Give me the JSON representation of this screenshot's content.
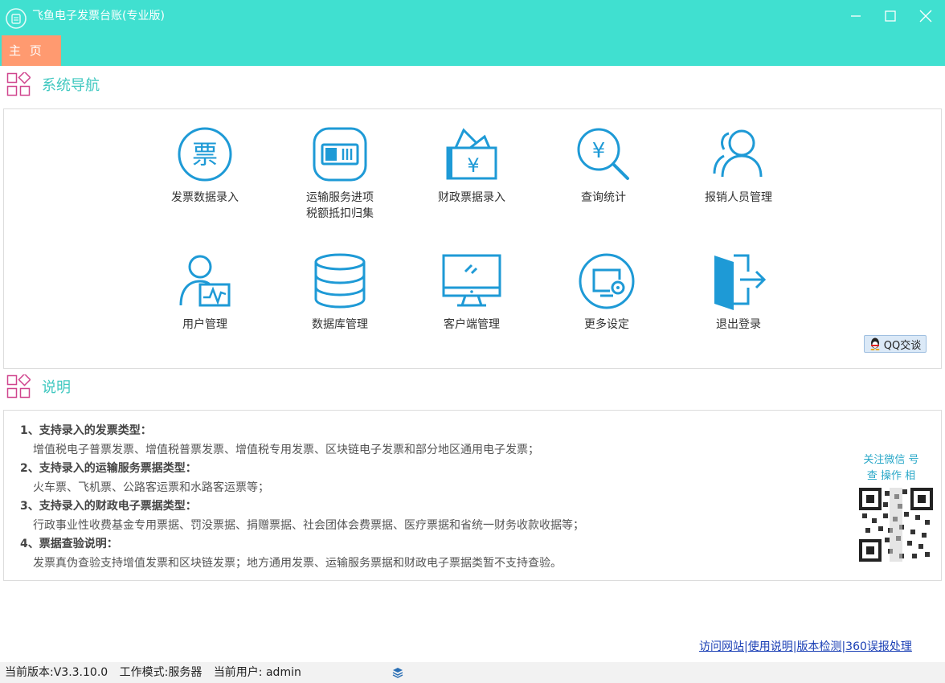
{
  "window": {
    "title": "飞鱼电子发票台账(专业版)",
    "tab_home": "主 页"
  },
  "colors": {
    "titlebar": "#40e0d0",
    "tab": "#ff9a70",
    "section_title": "#40c8c0",
    "icon_blue": "#1e9ad6",
    "link": "#1a3fb5"
  },
  "nav_section": {
    "title": "系统导航",
    "items": [
      {
        "label": "发票数据录入",
        "icon": "invoice-icon"
      },
      {
        "label": "运输服务进项\n税额抵扣归集",
        "icon": "ticket-icon"
      },
      {
        "label": "财政票据录入",
        "icon": "wallet-icon"
      },
      {
        "label": "查询统计",
        "icon": "search-yen-icon"
      },
      {
        "label": "报销人员管理",
        "icon": "users-icon"
      },
      {
        "label": "用户管理",
        "icon": "user-chart-icon"
      },
      {
        "label": "数据库管理",
        "icon": "database-icon"
      },
      {
        "label": "客户端管理",
        "icon": "monitor-icon"
      },
      {
        "label": "更多设定",
        "icon": "settings-icon"
      },
      {
        "label": "退出登录",
        "icon": "logout-icon"
      }
    ],
    "qq_button": "QQ交谈"
  },
  "desc_section": {
    "title": "说明",
    "items": [
      {
        "heading": "1、支持录入的发票类型：",
        "text": "增值税电子普票发票、增值税普票发票、增值税专用发票、区块链电子发票和部分地区通用电子发票；"
      },
      {
        "heading": "2、支持录入的运输服务票据类型：",
        "text": "火车票、飞机票、公路客运票和水路客运票等；"
      },
      {
        "heading": "3、支持录入的财政电子票据类型：",
        "text": "行政事业性收费基金专用票据、罚没票据、捐赠票据、社会团体会费票据、医疗票据和省统一财务收款收据等；"
      },
      {
        "heading": "4、票据查验说明：",
        "text": "发票真伪查验支持增值发票和区块链发票；地方通用发票、运输服务票据和财政电子票据类暂不支持查验。"
      }
    ],
    "wechat_line1": "关注微信    号",
    "wechat_line2": "查    操作   相"
  },
  "links": [
    "访问网站",
    "使用说明",
    "版本检测",
    "360误报处理"
  ],
  "status": {
    "version": "当前版本:V3.3.10.0",
    "mode": "工作模式:服务器",
    "user": "当前用户:  admin"
  }
}
